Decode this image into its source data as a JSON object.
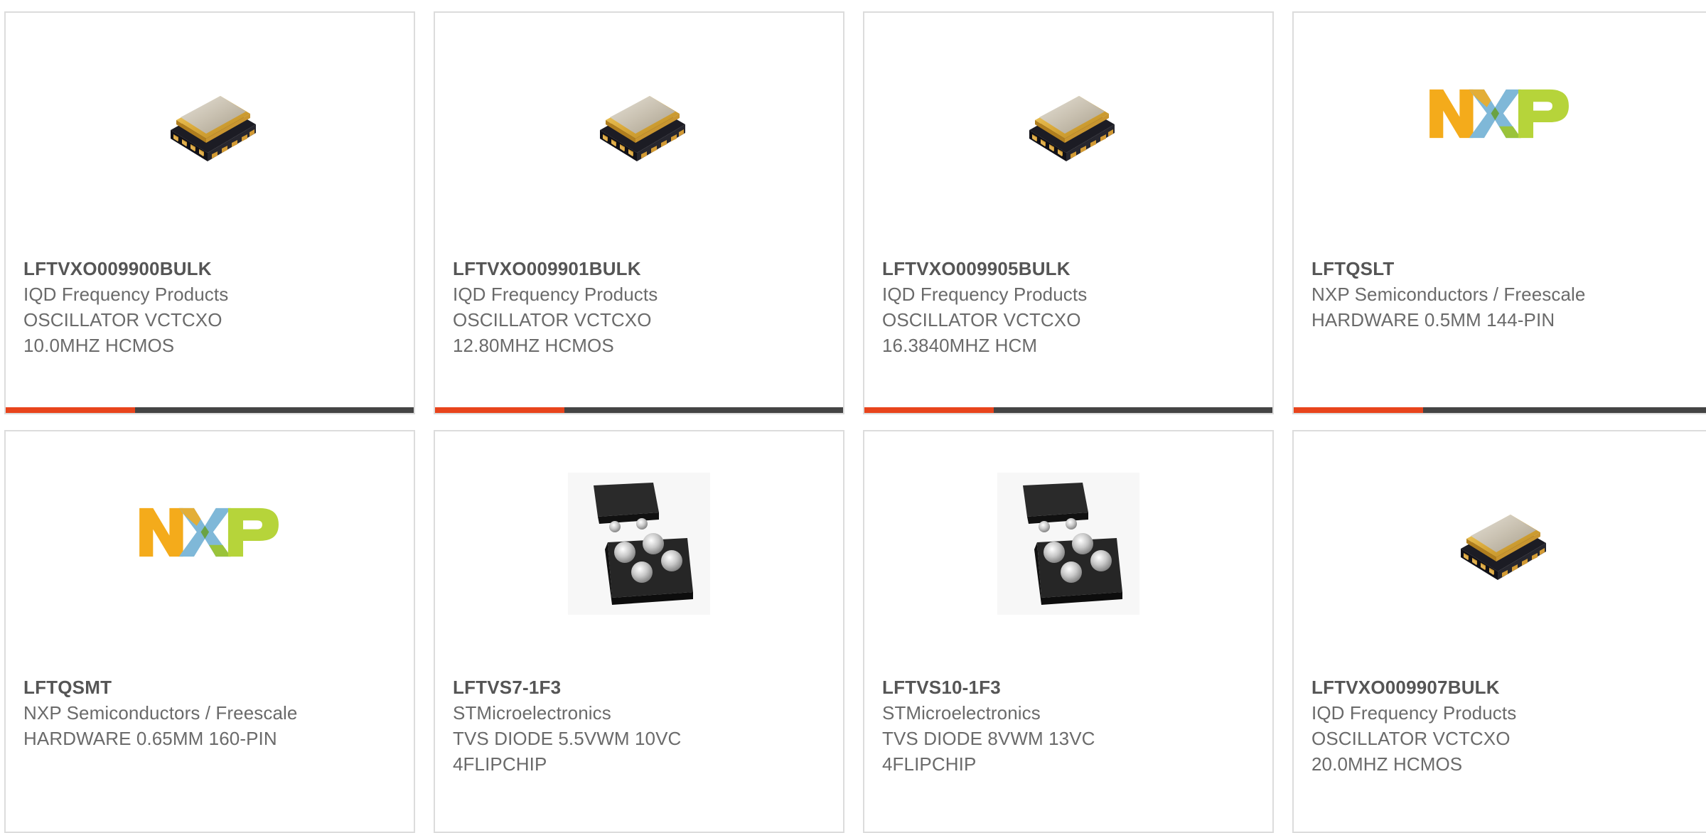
{
  "colors": {
    "accent": "#e8441c",
    "bar_dark": "#444444",
    "border": "#dcdcdc",
    "part_number_text": "#555555",
    "body_text": "#6a6a6a"
  },
  "products": [
    {
      "part_number": "LFTVXO009900BULK",
      "manufacturer": "IQD Frequency Products",
      "description": "OSCILLATOR VCTCXO\n10.0MHZ HCMOS",
      "image": "oscillator-image"
    },
    {
      "part_number": "LFTVXO009901BULK",
      "manufacturer": "IQD Frequency Products",
      "description": "OSCILLATOR VCTCXO\n12.80MHZ HCMOS",
      "image": "oscillator-image"
    },
    {
      "part_number": "LFTVXO009905BULK",
      "manufacturer": "IQD Frequency Products",
      "description": "OSCILLATOR VCTCXO\n16.3840MHZ HCM",
      "image": "oscillator-image"
    },
    {
      "part_number": "LFTQSLT",
      "manufacturer": "NXP Semiconductors / Freescale",
      "description": "HARDWARE 0.5MM 144-PIN",
      "image": "nxp-logo"
    },
    {
      "part_number": "LFTQSMT",
      "manufacturer": "NXP Semiconductors / Freescale",
      "description": "HARDWARE 0.65MM 160-PIN",
      "image": "nxp-logo"
    },
    {
      "part_number": "LFTVS7-1F3",
      "manufacturer": "STMicroelectronics",
      "description": "TVS DIODE 5.5VWM 10VC\n4FLIPCHIP",
      "image": "flipchip-image"
    },
    {
      "part_number": "LFTVS10-1F3",
      "manufacturer": "STMicroelectronics",
      "description": "TVS DIODE 8VWM 13VC\n4FLIPCHIP",
      "image": "flipchip-image"
    },
    {
      "part_number": "LFTVXO009907BULK",
      "manufacturer": "IQD Frequency Products",
      "description": "OSCILLATOR VCTCXO\n20.0MHZ HCMOS",
      "image": "oscillator-image"
    }
  ]
}
